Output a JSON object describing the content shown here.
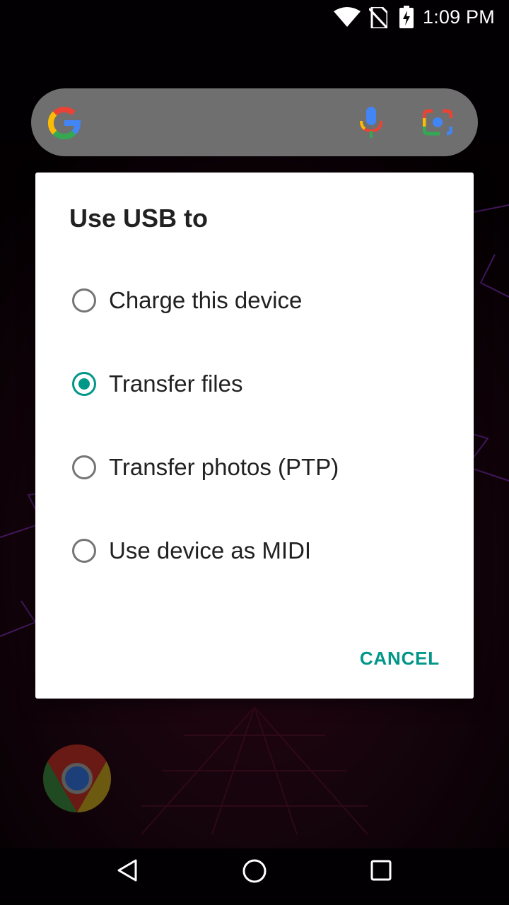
{
  "status_bar": {
    "time": "1:09 PM",
    "icons": [
      "wifi-icon",
      "no-sim-icon",
      "battery-charging-icon"
    ]
  },
  "search_bar": {
    "icons": [
      "google-logo-icon",
      "mic-icon",
      "google-lens-icon"
    ]
  },
  "dialog": {
    "title": "Use USB to",
    "options": [
      {
        "label": "Charge this device",
        "selected": false
      },
      {
        "label": "Transfer files",
        "selected": true
      },
      {
        "label": "Transfer photos (PTP)",
        "selected": false
      },
      {
        "label": "Use device as MIDI",
        "selected": false
      }
    ],
    "cancel_label": "CANCEL"
  },
  "home": {
    "apps": [
      "chrome-icon"
    ]
  },
  "nav_bar": {
    "buttons": [
      "back-icon",
      "home-icon",
      "recents-icon"
    ]
  },
  "colors": {
    "accent": "#009688",
    "scrim": "#000000",
    "dialog_bg": "#ffffff"
  }
}
